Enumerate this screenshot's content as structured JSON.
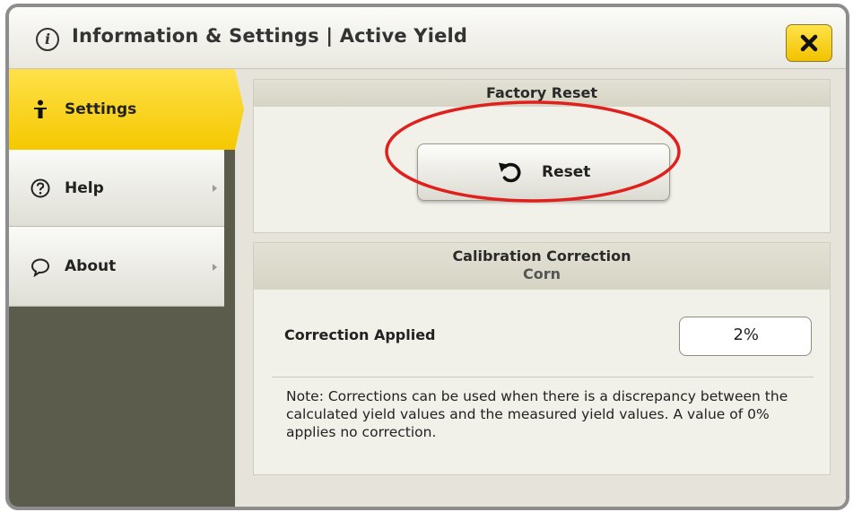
{
  "window": {
    "title": "Information & Settings | Active Yield"
  },
  "sidebar": {
    "items": [
      {
        "label": "Settings",
        "icon": "person-icon",
        "active": true
      },
      {
        "label": "Help",
        "icon": "question-icon",
        "active": false
      },
      {
        "label": "About",
        "icon": "speech-bubble-icon",
        "active": false
      }
    ]
  },
  "factory_reset": {
    "heading": "Factory Reset",
    "button_label": "Reset",
    "highlight_color": "#e0201c"
  },
  "calibration": {
    "heading": "Calibration Correction",
    "subheading": "Corn",
    "correction_label": "Correction Applied",
    "correction_value": "2%",
    "note": "Note: Corrections can be used when there is a discrepancy between the calculated yield values and the measured yield values. A value of 0% applies no correction."
  },
  "colors": {
    "accent": "#f5c800",
    "sidebar_bg": "#5c5c4c"
  }
}
